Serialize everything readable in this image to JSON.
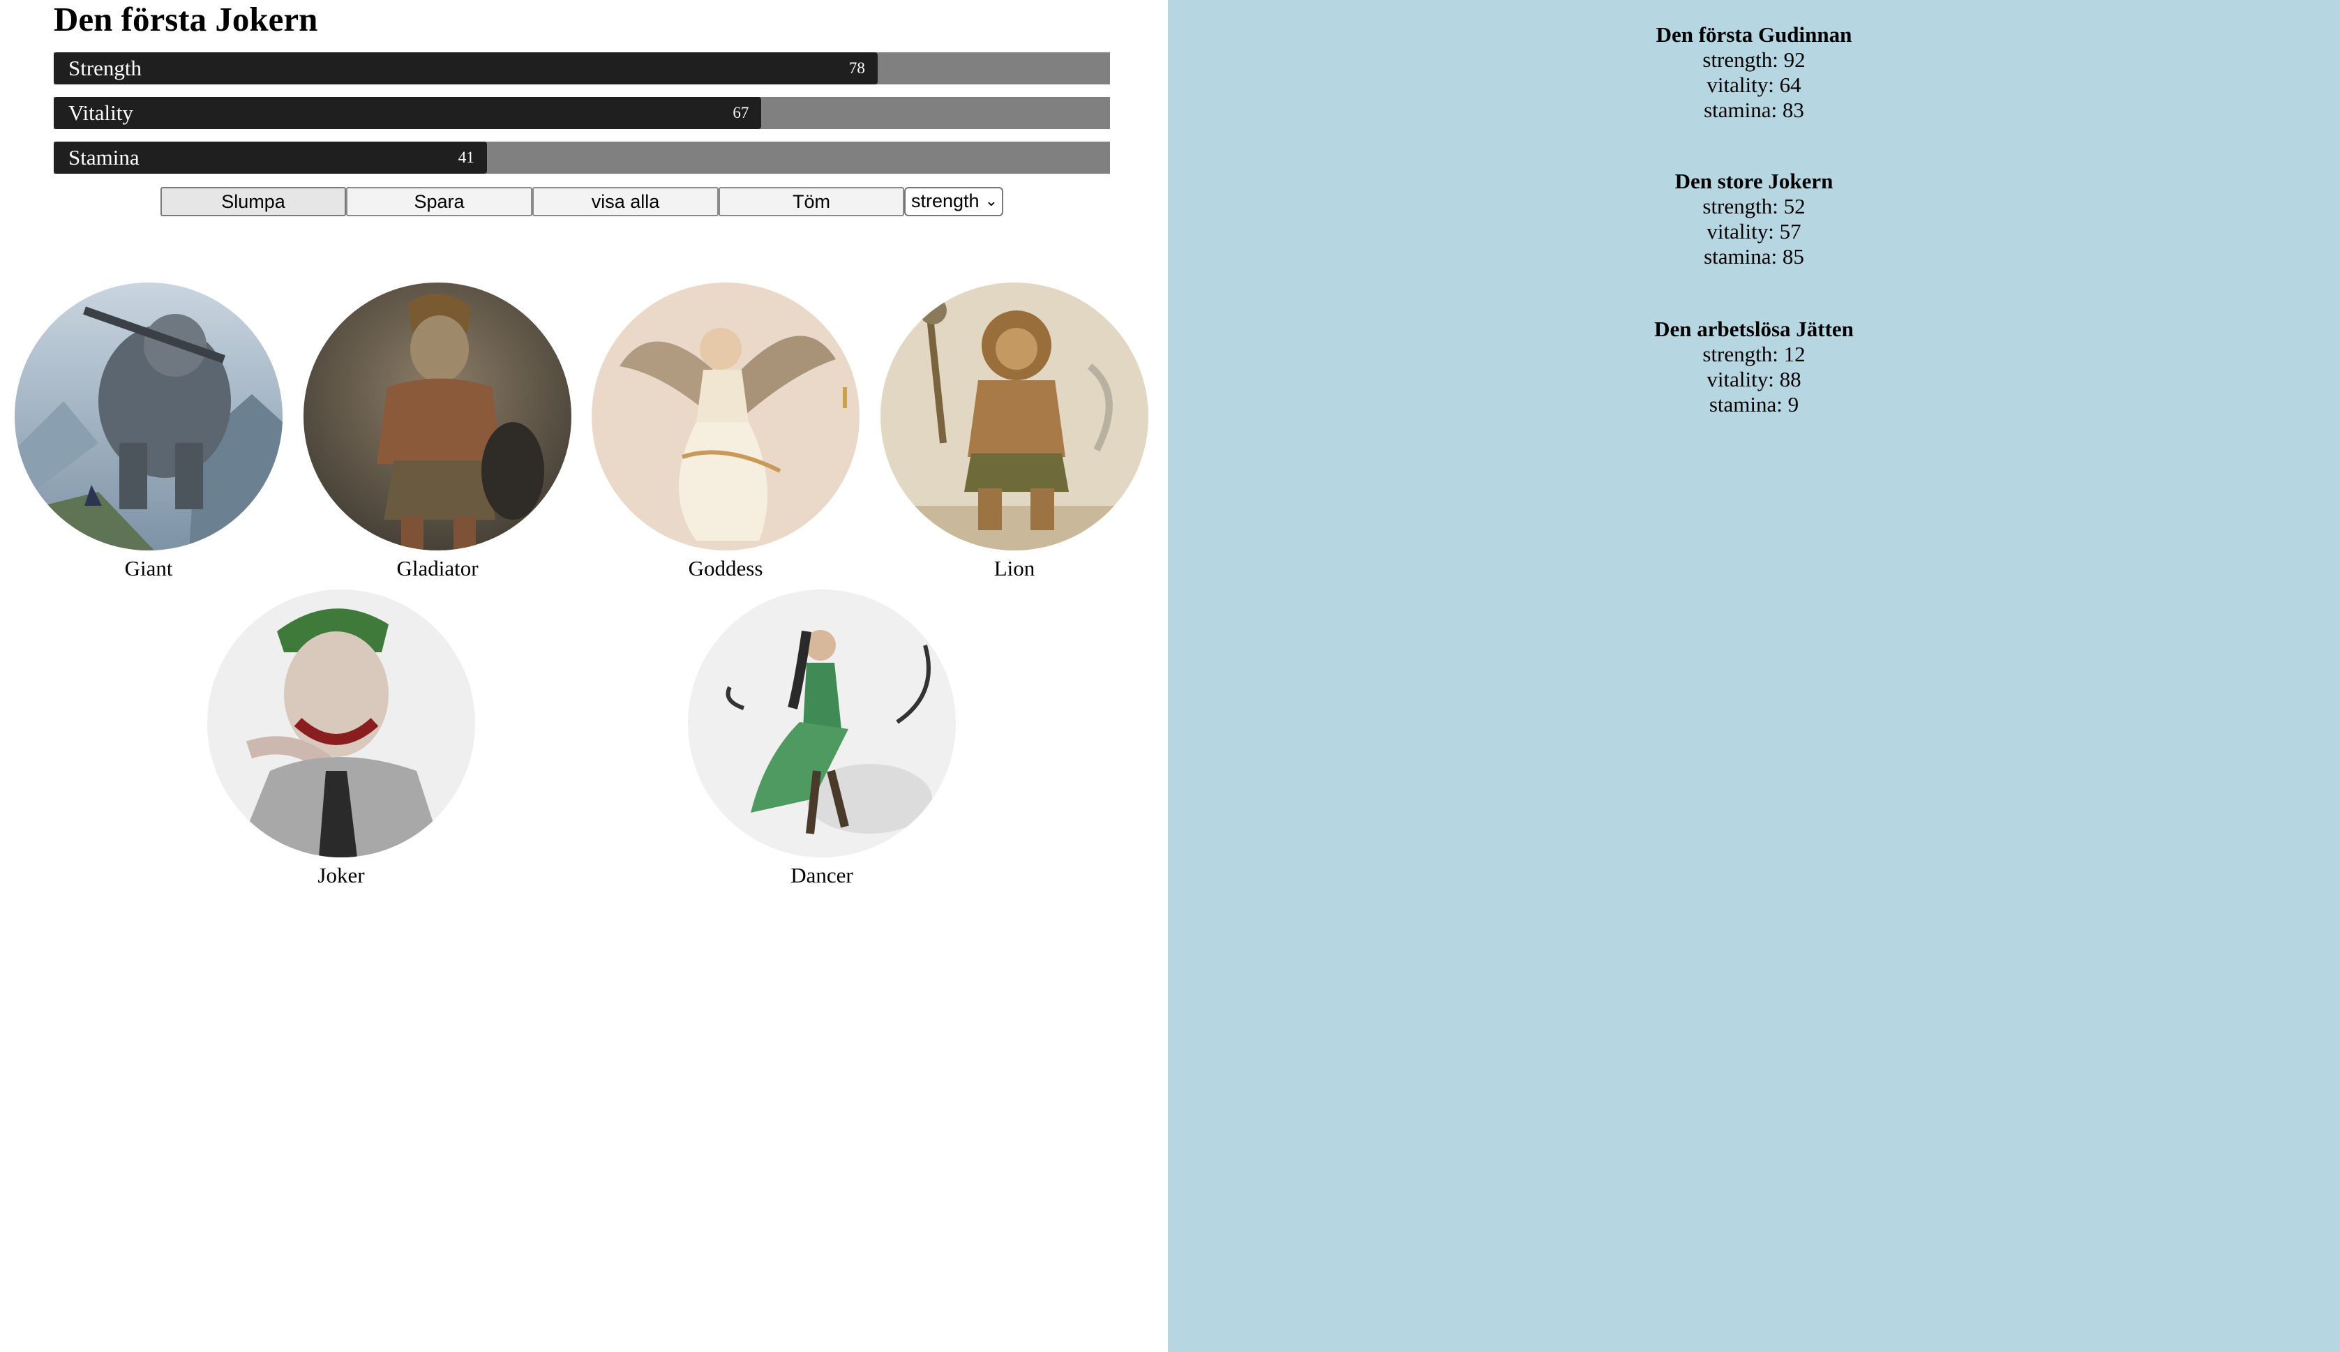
{
  "selected_character": {
    "title": "Den första Jokern",
    "stats": [
      {
        "label": "Strength",
        "value": 78,
        "percent": 78
      },
      {
        "label": "Vitality",
        "value": 67,
        "percent": 67
      },
      {
        "label": "Stamina",
        "value": 41,
        "percent": 41
      }
    ]
  },
  "controls": {
    "buttons": [
      "Slumpa",
      "Spara",
      "visa alla",
      "Töm"
    ],
    "sort_select": {
      "selected": "strength"
    }
  },
  "characters": [
    {
      "name": "Giant",
      "image": "giant-portrait"
    },
    {
      "name": "Gladiator",
      "image": "gladiator-portrait"
    },
    {
      "name": "Goddess",
      "image": "goddess-portrait"
    },
    {
      "name": "Lion",
      "image": "lion-portrait"
    },
    {
      "name": "Joker",
      "image": "joker-portrait"
    },
    {
      "name": "Dancer",
      "image": "dancer-portrait"
    }
  ],
  "saved_characters": [
    {
      "name": "Den första Gudinnan",
      "strength": "strength: 92",
      "vitality": "vitality: 64",
      "stamina": "stamina: 83"
    },
    {
      "name": "Den store Jokern",
      "strength": "strength: 52",
      "vitality": "vitality: 57",
      "stamina": "stamina: 85"
    },
    {
      "name": "Den arbetslösa Jätten",
      "strength": "strength: 12",
      "vitality": "vitality: 88",
      "stamina": "stamina: 9"
    }
  ],
  "colors": {
    "sidebar_background": "#b6d7e2",
    "bar_track": "#808080",
    "bar_fill": "#1f1f1f"
  }
}
